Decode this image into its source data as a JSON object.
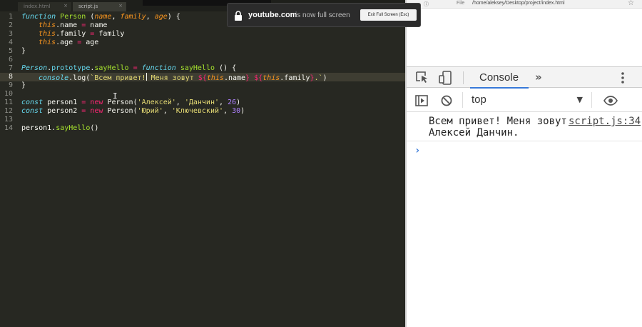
{
  "editor": {
    "tabs": [
      {
        "label": "index.html"
      },
      {
        "label": "script.js"
      }
    ],
    "active_line": 8,
    "line_numbers": [
      "1",
      "2",
      "3",
      "4",
      "5",
      "6",
      "7",
      "8",
      "9",
      "10",
      "11",
      "12",
      "13",
      "14"
    ],
    "code": {
      "l1_kw": "function",
      "l1_name": " Person ",
      "l1_open": "(",
      "l1_p1": "name",
      "l1_c1": ", ",
      "l1_p2": "family",
      "l1_c2": ", ",
      "l1_p3": "age",
      "l1_close": ") {",
      "l2_this": "this",
      "l2_rest": ".name ",
      "l2_eq": "=",
      "l2_val": " name",
      "l3_this": "this",
      "l3_rest": ".family ",
      "l3_eq": "=",
      "l3_val": " family",
      "l4_this": "this",
      "l4_rest": ".age ",
      "l4_eq": "=",
      "l4_val": " age",
      "l5": "}",
      "l7_cls": "Person",
      "l7_dot": ".",
      "l7_proto": "prototype",
      "l7_dot2": ".",
      "l7_meth": "sayHello",
      "l7_sp": " ",
      "l7_eq": "=",
      "l7_sp2": " ",
      "l7_kw": "function",
      "l7_fn": " sayHello",
      "l7_rest": " () {",
      "l8_obj": "console",
      "l8_log": ".log(",
      "l8_str1": "`Всем привет!",
      "l8_str2": " Меня зовут ",
      "l8_int1": "${",
      "l8_this1": "this",
      "l8_prop1": ".name",
      "l8_int1c": "}",
      "l8_sp": " ",
      "l8_int2": "${",
      "l8_this2": "this",
      "l8_prop2": ".family",
      "l8_int2c": "}",
      "l8_str3": ".`",
      "l8_close": ")",
      "l9": "}",
      "l11_kw": "const",
      "l11_var": " person1 ",
      "l11_eq": "=",
      "l11_sp": " ",
      "l11_new": "new",
      "l11_cls": " Person(",
      "l11_s1": "'Алексей'",
      "l11_c1": ", ",
      "l11_s2": "'Данчин'",
      "l11_c2": ", ",
      "l11_n": "26",
      "l11_close": ")",
      "l12_kw": "const",
      "l12_var": " person2 ",
      "l12_eq": "=",
      "l12_sp": " ",
      "l12_new": "new",
      "l12_cls": " Person(",
      "l12_s1": "'Юрий'",
      "l12_c1": ", ",
      "l12_s2": "'Ключевский'",
      "l12_c2": ", ",
      "l12_n": "30",
      "l12_close": ")",
      "l14_obj": "person1",
      "l14_dot": ".",
      "l14_meth": "sayHello",
      "l14_rest": "()"
    }
  },
  "fullscreen_notice": {
    "site": "youtube.com",
    "message": "is now full screen",
    "exit_label": "Exit Full Screen (Esc)"
  },
  "browser": {
    "address": {
      "info_label": "ⓘ File",
      "url": "/home/aleksey/Desktop/project/index.html"
    }
  },
  "devtools": {
    "tab_console": "Console",
    "more_tabs": "»",
    "context": "top",
    "log": {
      "text": "Всем привет! Меня зовут Алексей Данчин.",
      "source": "script.js:34"
    },
    "prompt": "›"
  },
  "colors": {
    "editor_bg": "#272822",
    "keyword": "#66d9ef",
    "operator": "#f92672",
    "function": "#a6e22e",
    "param": "#fd971f",
    "string": "#e6db74",
    "number": "#ae81ff",
    "accent": "#3879d9"
  }
}
